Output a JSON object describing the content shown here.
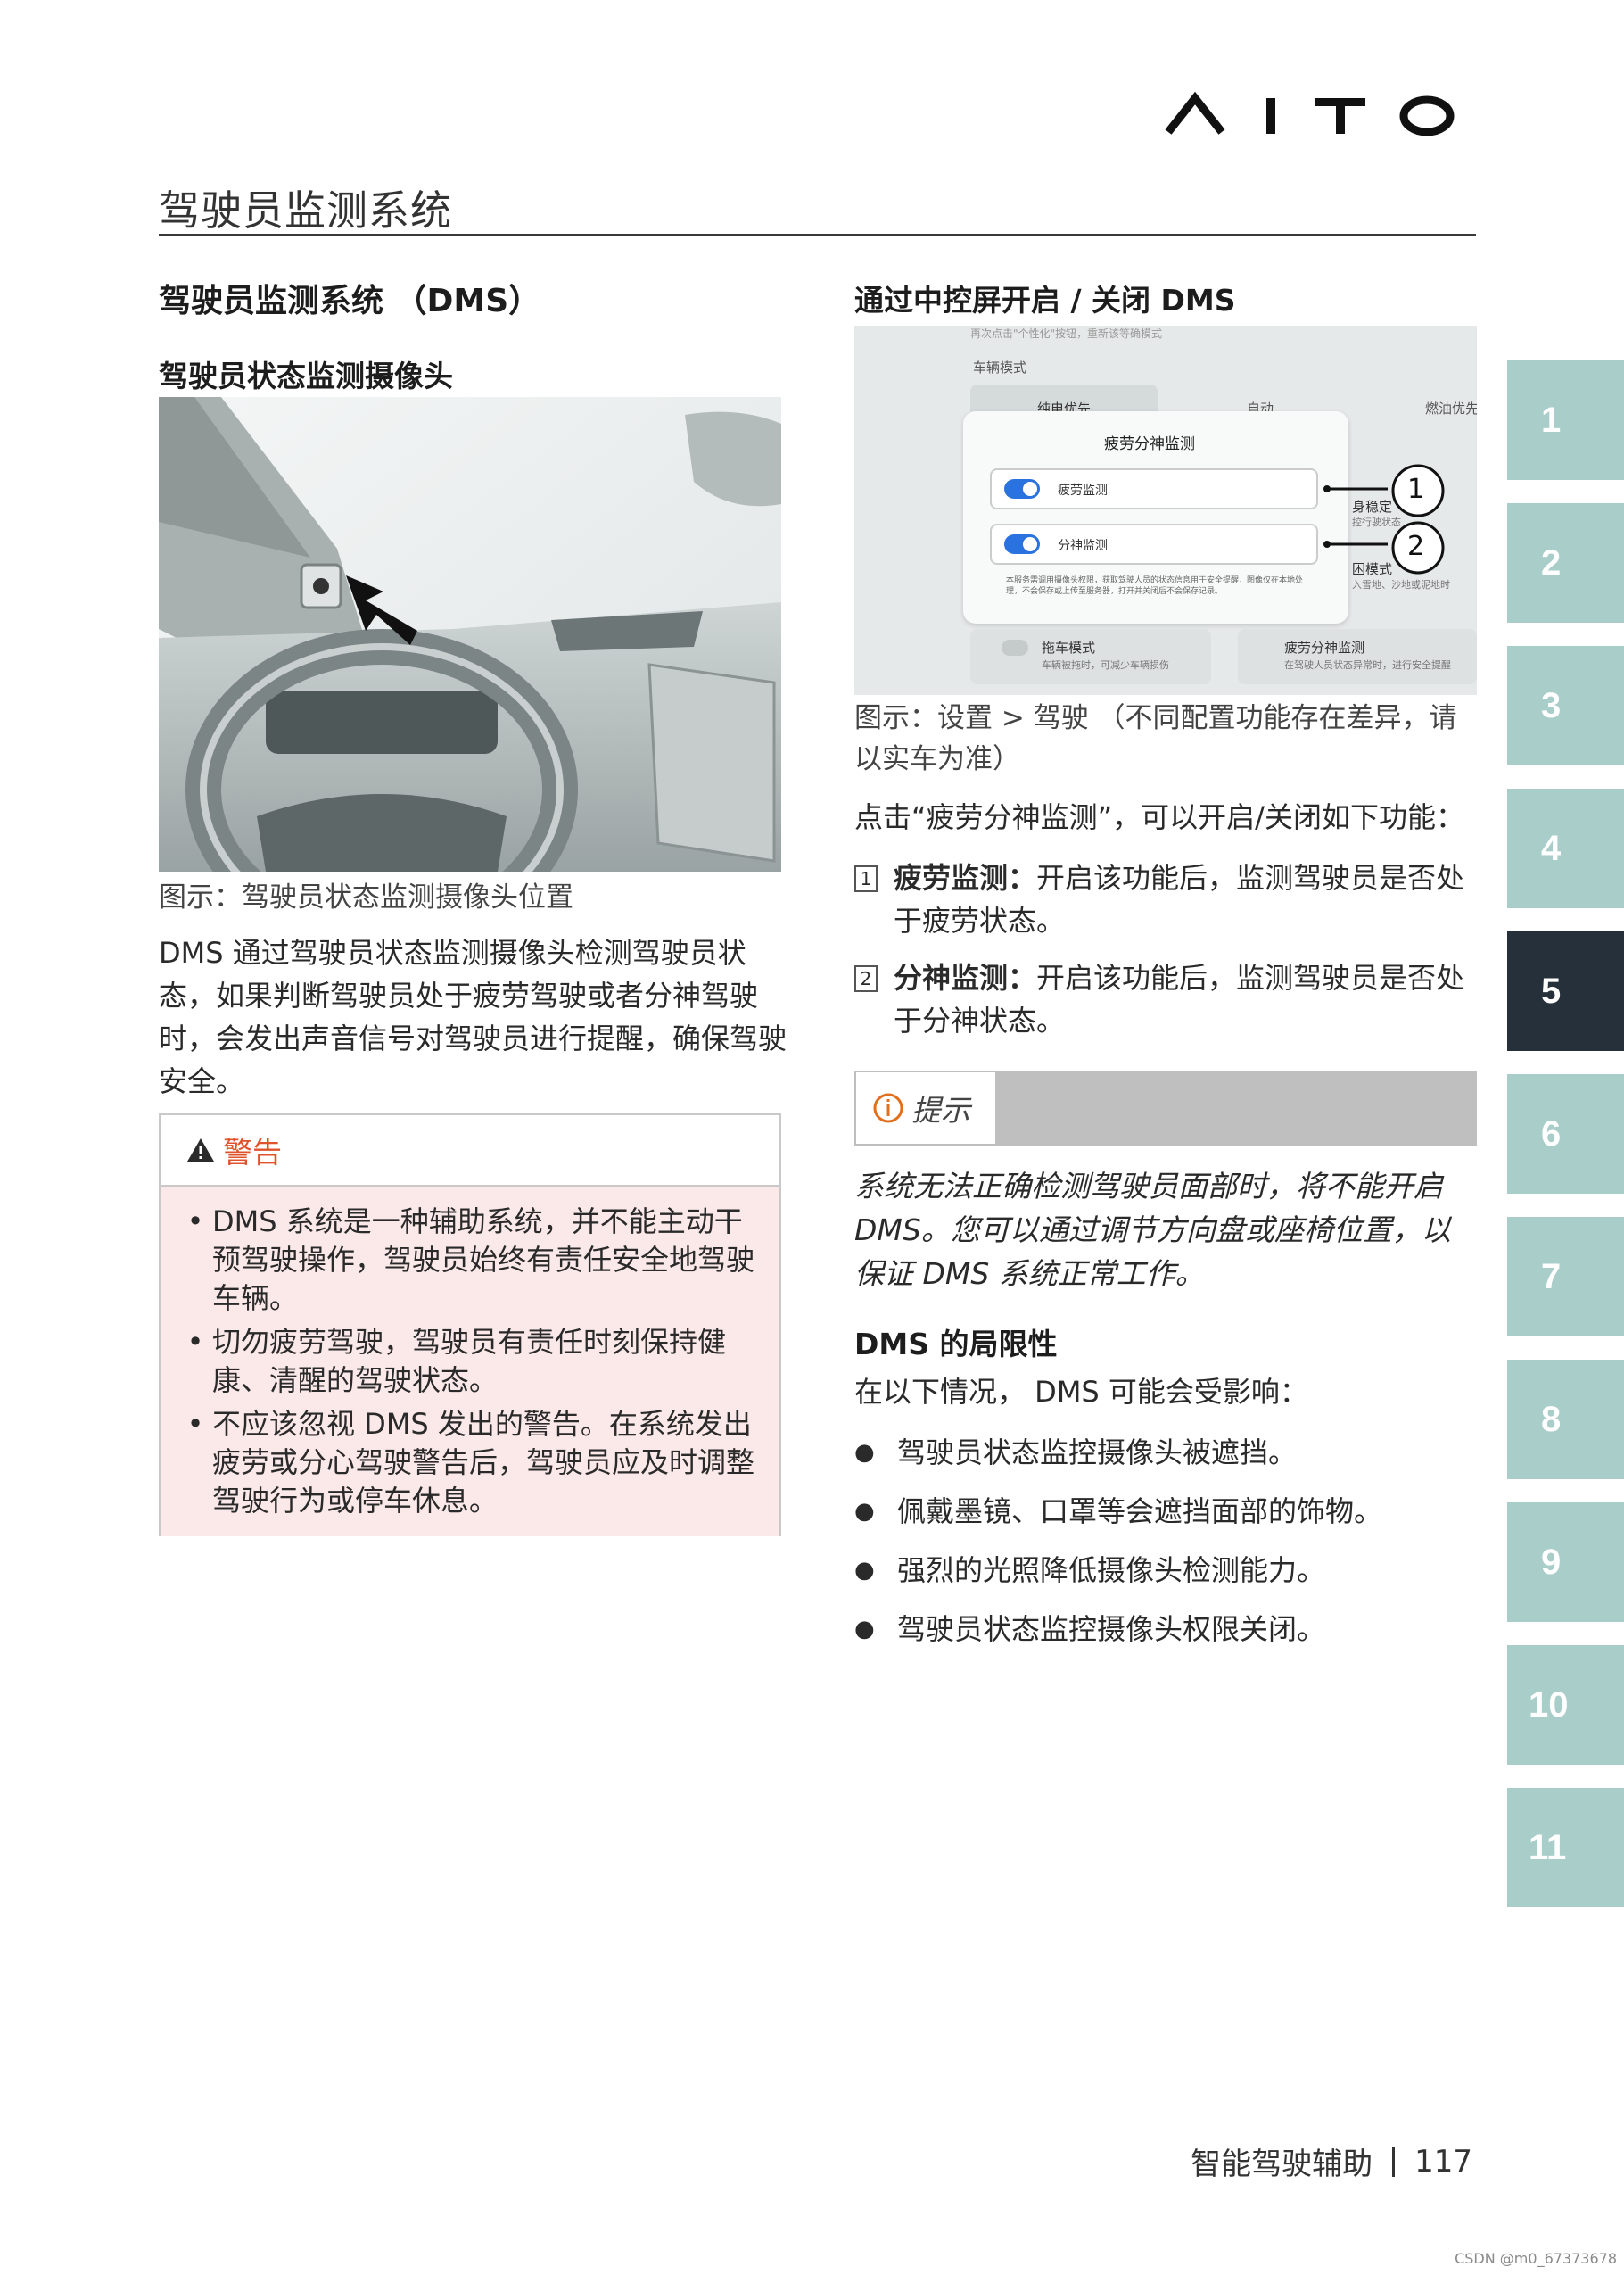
{
  "brand": "AITO",
  "section_title": "驾驶员监测系统",
  "left": {
    "heading": "驾驶员监测系统 （DMS）",
    "subheading": "驾驶员状态监测摄像头",
    "figure_caption": "图示：驾驶员状态监测摄像头位置",
    "paragraph": "DMS 通过驾驶员状态监测摄像头检测驾驶员状态，如果判断驾驶员处于疲劳驾驶或者分神驾驶时，会发出声音信号对驾驶员进行提醒，确保驾驶安全。",
    "warning": {
      "title": "警告",
      "items": [
        "DMS 系统是一种辅助系统，并不能主动干预驾驶操作，驾驶员始终有责任安全地驾驶车辆。",
        "切勿疲劳驾驶，驾驶员有责任时刻保持健康、清醒的驾驶状态。",
        "不应该忽视 DMS 发出的警告。在系统发出疲劳或分心驾驶警告后，驾驶员应及时调整驾驶行为或停车休息。"
      ]
    }
  },
  "right": {
    "heading": "通过中控屏开启 / 关闭 DMS",
    "screen": {
      "top_text": "再次点击\"个性化\"按钮，重新该等确模式",
      "vehicle_mode_label": "车辆模式",
      "mode_ev": "纯电优先",
      "mode_auto": "自动",
      "mode_fuel": "燃油优先",
      "popup_title": "疲劳分神监测",
      "toggle1": "疲劳监测",
      "toggle2": "分神监测",
      "callout1": "1",
      "callout2": "2",
      "fine_print": "本服务需调用摄像头权限，获取驾驶人员的状态信息用于安全提醒，图像仅在本地处理，不会保存或上传至服务器，打开并关闭后不会保存记录。",
      "side1": "身稳定",
      "side1b": "控行驶状态",
      "side2": "困模式",
      "side2b": "入雪地、沙地或泥地时",
      "tow_title": "拖车模式",
      "tow_desc": "车辆被拖时，可减少车辆损伤",
      "fatigue_title": "疲劳分神监测",
      "fatigue_desc": "在驾驶人员状态异常时，进行安全提醒"
    },
    "figure_caption": "图示：设置 > 驾驶 （不同配置功能存在差异，请以实车为准）",
    "intro": "点击“疲劳分神监测”，可以开启/关闭如下功能：",
    "features": [
      {
        "num": "1",
        "name": "疲劳监测：",
        "desc": "开启该功能后，监测驾驶员是否处于疲劳状态。"
      },
      {
        "num": "2",
        "name": "分神监测：",
        "desc": "开启该功能后，监测驾驶员是否处于分神状态。"
      }
    ],
    "tip": {
      "label": "提示",
      "text": "系统无法正确检测驾驶员面部时，将不能开启 DMS。您可以通过调节方向盘或座椅位置，以保证 DMS 系统正常工作。"
    },
    "limits_heading": "DMS 的局限性",
    "limits_intro": "在以下情况， DMS 可能会受影响：",
    "limits": [
      "驾驶员状态监控摄像头被遮挡。",
      "佩戴墨镜、口罩等会遮挡面部的饰物。",
      "强烈的光照降低摄像头检测能力。",
      "驾驶员状态监控摄像头权限关闭。"
    ]
  },
  "tabs": [
    "1",
    "2",
    "3",
    "4",
    "5",
    "6",
    "7",
    "8",
    "9",
    "10",
    "11"
  ],
  "active_tab": "5",
  "footer": {
    "chapter": "智能驾驶辅助",
    "page": "117"
  },
  "watermark": "CSDN @m0_67373678",
  "colors": {
    "tab": "#a9cdc9",
    "tab_active": "#26303a",
    "warning_bg": "#fbe9e9",
    "warning_accent": "#e0532a",
    "tip_bar": "#bfbfbf"
  }
}
